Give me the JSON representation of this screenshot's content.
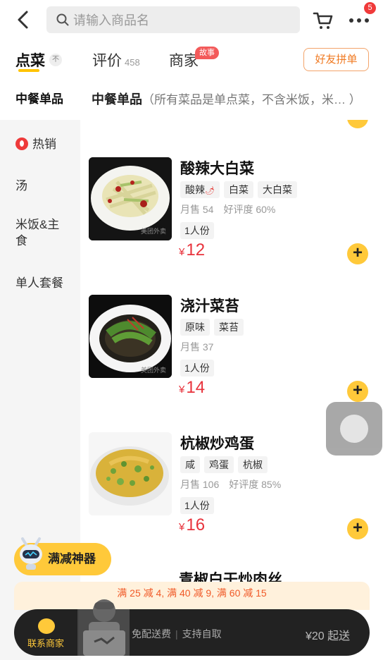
{
  "search": {
    "placeholder": "请输入商品名"
  },
  "header": {
    "cart_badge": "5"
  },
  "tabs": [
    {
      "label": "点菜",
      "down_mark": "不"
    },
    {
      "label": "评价",
      "count": "458"
    },
    {
      "label": "商家",
      "badge": "故事"
    }
  ],
  "friend_order_label": "好友拼单",
  "sidebar": {
    "items": [
      {
        "label": "中餐单品"
      },
      {
        "label": "热销"
      },
      {
        "label": "汤"
      },
      {
        "label": "米饭&主食"
      },
      {
        "label": "单人套餐"
      }
    ]
  },
  "section": {
    "title": "中餐单品",
    "subtitle": "（所有菜品是单点菜，不含米饭，米… ）"
  },
  "products": [
    {
      "name": "酸辣大白菜",
      "tags": [
        "酸辣",
        "白菜",
        "大白菜"
      ],
      "sales": "月售 54",
      "rating": "好评度 60%",
      "portion": "1人份",
      "currency": "¥",
      "price": "12"
    },
    {
      "name": "浇汁菜苔",
      "tags": [
        "原味",
        "菜苔"
      ],
      "sales": "月售 37",
      "rating": "",
      "portion": "1人份",
      "currency": "¥",
      "price": "14"
    },
    {
      "name": "杭椒炒鸡蛋",
      "tags": [
        "咸",
        "鸡蛋",
        "杭椒"
      ],
      "sales": "月售 106",
      "rating": "好评度 85%",
      "portion": "1人份",
      "currency": "¥",
      "price": "16"
    },
    {
      "name": "青椒白干炒肉丝"
    }
  ],
  "image_watermark": "美团外卖",
  "promo_button": "满减神器",
  "discount_text": "满 25 减 4, 满 40 减 9, 满 60 减 15",
  "bottom_bar": {
    "contact": "联系商家",
    "free_delivery": "免配送费",
    "self_pickup": "支持自取",
    "min_order": "¥20 起送"
  },
  "colors": {
    "accent_yellow": "#ffc93a",
    "price_red": "#e8333c",
    "dark_bar": "#222222"
  }
}
